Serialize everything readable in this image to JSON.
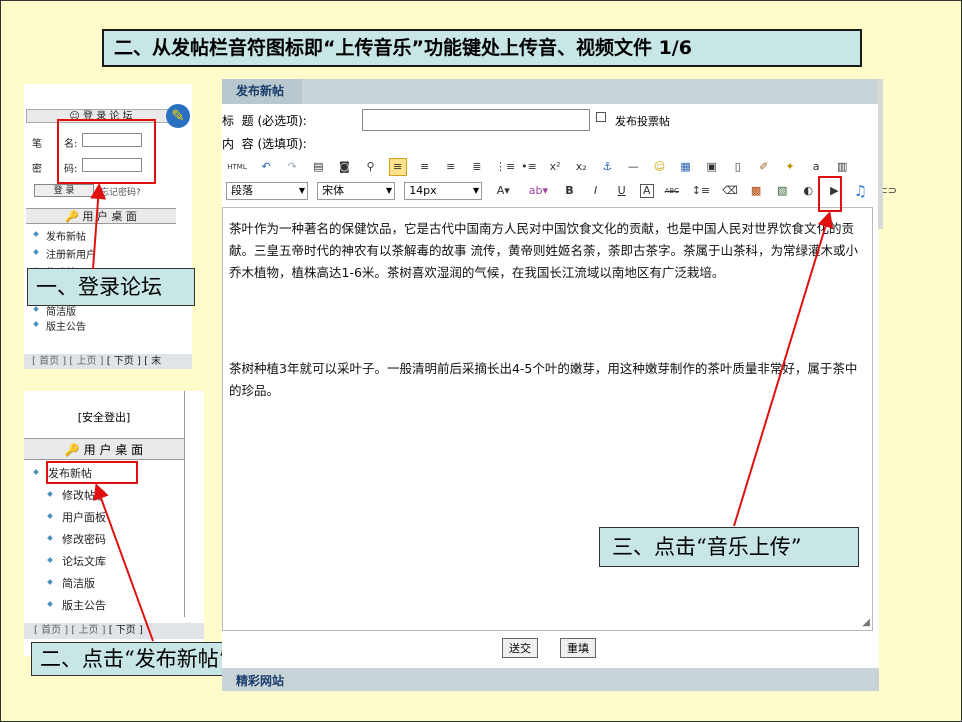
{
  "slide": {
    "title": "二、从发帖栏音符图标即“上传音乐”功能键处上传音、视频文件 1/6",
    "callout_login": "一、登录论坛",
    "callout_post": "二、点击“发布新帖”",
    "callout_music": "三、点击“音乐上传”"
  },
  "login_panel": {
    "header": "登 录 论 坛",
    "name_label": "名:",
    "name_prefix": "笔",
    "pwd_label": "码:",
    "pwd_prefix": "密",
    "login_button": "登 录",
    "forgot_link": "忘记密码?",
    "user_desk": "用 户 桌 面",
    "items": [
      "发布新帖",
      "注册新用户",
      "修改帖子"
    ],
    "items_lower": [
      "简洁版",
      "版主公告"
    ],
    "pager": [
      "[ 首页 ]",
      "[ 上页 ]",
      "[ 下页 ]",
      "[ 末"
    ]
  },
  "user_panel": {
    "logout": "[安全登出]",
    "header": "用 户 桌 面",
    "items": [
      "发布新帖",
      "修改帖子",
      "用户面板",
      "修改密码",
      "论坛文库",
      "简洁版",
      "版主公告"
    ],
    "pager": [
      "[ 首页 ]",
      "[ 上页 ]",
      "[ 下页 ]"
    ]
  },
  "editor": {
    "tab_title": "发布新帖",
    "title_label": "标  题 (必选项):",
    "content_label": "内  容 (选填项):",
    "vote_label": "发布投票帖",
    "toolbar_html": "HTML",
    "format_select": "段落",
    "font_select": "宋体",
    "size_select": "14px",
    "paragraph1": "茶叶作为一种著名的保健饮品，它是古代中国南方人民对中国饮食文化的贡献，也是中国人民对世界饮食文化的贡献。三皇五帝时代的神农有以茶解毒的故事 流传，黄帝则姓姬名荼，荼即古茶字。茶属于山茶科，为常绿灌木或小乔木植物，植株高达1-6米。茶树喜欢湿润的气候，在我国长江流域以南地区有广泛栽培。",
    "paragraph2": "茶树种植3年就可以采叶子。一般清明前后采摘长出4-5个叶的嫩芽，用这种嫩芽制作的茶叶质量非常好，属于茶中的珍品。",
    "submit_button": "送交",
    "reset_button": "重填",
    "footer_tab": "精彩网站"
  },
  "colors": {
    "slide_bg": "#fffccc",
    "callout_bg": "#c8e6e6",
    "highlight_red": "#e01010",
    "tab_bg": "#c8d4d8"
  }
}
